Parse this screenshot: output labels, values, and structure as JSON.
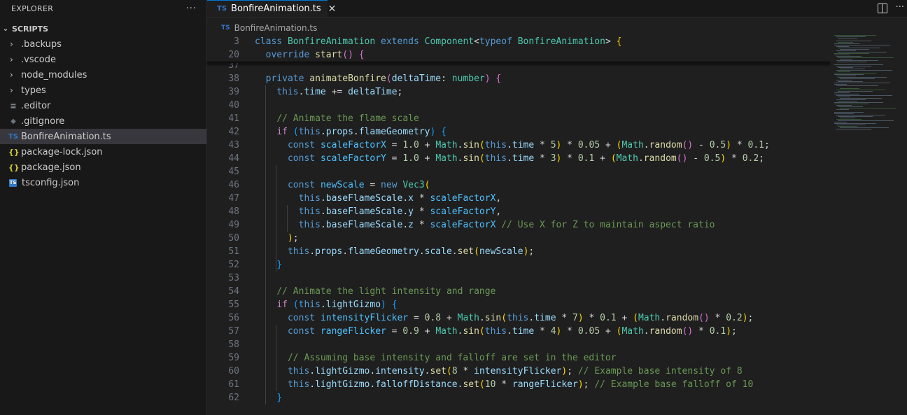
{
  "sidebar": {
    "title": "EXPLORER",
    "more": "···",
    "section": "SCRIPTS",
    "folders": [
      ".backups",
      ".vscode",
      "node_modules",
      "types"
    ],
    "files": [
      {
        "name": ".editor",
        "icon": "lines-icon"
      },
      {
        "name": ".gitignore",
        "icon": "git-icon"
      },
      {
        "name": "BonfireAnimation.ts",
        "icon": "ts-icon"
      },
      {
        "name": "package-lock.json",
        "icon": "json-icon"
      },
      {
        "name": "package.json",
        "icon": "json-icon"
      },
      {
        "name": "tsconfig.json",
        "icon": "ts-config-icon"
      }
    ]
  },
  "tab": {
    "label": "BonfireAnimation.ts",
    "badge": "TS",
    "close": "✕"
  },
  "breadcrumb": {
    "badge": "TS",
    "file": "BonfireAnimation.ts"
  },
  "editor": {
    "sticky": [
      {
        "n": "3",
        "tokens": [
          [
            "kw",
            "class "
          ],
          [
            "ty",
            "BonfireAnimation "
          ],
          [
            "kw",
            "extends "
          ],
          [
            "ty",
            "Component"
          ],
          [
            "pl",
            "<"
          ],
          [
            "kw",
            "typeof "
          ],
          [
            "ty",
            "BonfireAnimation"
          ],
          [
            "pl",
            "> "
          ],
          [
            "b1",
            "{"
          ]
        ]
      },
      {
        "n": "20",
        "tokens": [
          [
            "pl",
            "  "
          ],
          [
            "kw",
            "override "
          ],
          [
            "fn",
            "start"
          ],
          [
            "b2",
            "()"
          ],
          [
            "pl",
            " "
          ],
          [
            "b2",
            "{"
          ]
        ]
      }
    ],
    "lines": [
      {
        "n": "37",
        "tokens": []
      },
      {
        "n": "38",
        "tokens": [
          [
            "pl",
            "  "
          ],
          [
            "kw",
            "private "
          ],
          [
            "fn",
            "animateBonfire"
          ],
          [
            "b2",
            "("
          ],
          [
            "vr",
            "deltaTime"
          ],
          [
            "pl",
            ": "
          ],
          [
            "ty",
            "number"
          ],
          [
            "b2",
            ")"
          ],
          [
            "pl",
            " "
          ],
          [
            "b2",
            "{"
          ]
        ]
      },
      {
        "n": "39",
        "tokens": [
          [
            "pl",
            "    "
          ],
          [
            "kw",
            "this"
          ],
          [
            "pl",
            "."
          ],
          [
            "vr",
            "time"
          ],
          [
            "pl",
            " += "
          ],
          [
            "vr",
            "deltaTime"
          ],
          [
            "pl",
            ";"
          ]
        ]
      },
      {
        "n": "40",
        "tokens": []
      },
      {
        "n": "41",
        "tokens": [
          [
            "pl",
            "    "
          ],
          [
            "cm",
            "// Animate the flame scale"
          ]
        ]
      },
      {
        "n": "42",
        "tokens": [
          [
            "pl",
            "    "
          ],
          [
            "ck",
            "if "
          ],
          [
            "b3",
            "("
          ],
          [
            "kw",
            "this"
          ],
          [
            "pl",
            "."
          ],
          [
            "vr",
            "props"
          ],
          [
            "pl",
            "."
          ],
          [
            "vr",
            "flameGeometry"
          ],
          [
            "b3",
            ")"
          ],
          [
            "pl",
            " "
          ],
          [
            "b3",
            "{"
          ]
        ]
      },
      {
        "n": "43",
        "tokens": [
          [
            "pl",
            "      "
          ],
          [
            "kw",
            "const "
          ],
          [
            "cn",
            "scaleFactorX"
          ],
          [
            "pl",
            " = "
          ],
          [
            "nm",
            "1.0"
          ],
          [
            "pl",
            " + "
          ],
          [
            "ty",
            "Math"
          ],
          [
            "pl",
            "."
          ],
          [
            "fn",
            "sin"
          ],
          [
            "b1",
            "("
          ],
          [
            "kw",
            "this"
          ],
          [
            "pl",
            "."
          ],
          [
            "vr",
            "time"
          ],
          [
            "pl",
            " * "
          ],
          [
            "nm",
            "5"
          ],
          [
            "b1",
            ")"
          ],
          [
            "pl",
            " * "
          ],
          [
            "nm",
            "0.05"
          ],
          [
            "pl",
            " + "
          ],
          [
            "b1",
            "("
          ],
          [
            "ty",
            "Math"
          ],
          [
            "pl",
            "."
          ],
          [
            "fn",
            "random"
          ],
          [
            "b2",
            "()"
          ],
          [
            "pl",
            " - "
          ],
          [
            "nm",
            "0.5"
          ],
          [
            "b1",
            ")"
          ],
          [
            "pl",
            " * "
          ],
          [
            "nm",
            "0.1"
          ],
          [
            "pl",
            ";"
          ]
        ]
      },
      {
        "n": "44",
        "tokens": [
          [
            "pl",
            "      "
          ],
          [
            "kw",
            "const "
          ],
          [
            "cn",
            "scaleFactorY"
          ],
          [
            "pl",
            " = "
          ],
          [
            "nm",
            "1.0"
          ],
          [
            "pl",
            " + "
          ],
          [
            "ty",
            "Math"
          ],
          [
            "pl",
            "."
          ],
          [
            "fn",
            "sin"
          ],
          [
            "b1",
            "("
          ],
          [
            "kw",
            "this"
          ],
          [
            "pl",
            "."
          ],
          [
            "vr",
            "time"
          ],
          [
            "pl",
            " * "
          ],
          [
            "nm",
            "3"
          ],
          [
            "b1",
            ")"
          ],
          [
            "pl",
            " * "
          ],
          [
            "nm",
            "0.1"
          ],
          [
            "pl",
            " + "
          ],
          [
            "b1",
            "("
          ],
          [
            "ty",
            "Math"
          ],
          [
            "pl",
            "."
          ],
          [
            "fn",
            "random"
          ],
          [
            "b2",
            "()"
          ],
          [
            "pl",
            " - "
          ],
          [
            "nm",
            "0.5"
          ],
          [
            "b1",
            ")"
          ],
          [
            "pl",
            " * "
          ],
          [
            "nm",
            "0.2"
          ],
          [
            "pl",
            ";"
          ]
        ]
      },
      {
        "n": "45",
        "tokens": []
      },
      {
        "n": "46",
        "tokens": [
          [
            "pl",
            "      "
          ],
          [
            "kw",
            "const "
          ],
          [
            "cn",
            "newScale"
          ],
          [
            "pl",
            " = "
          ],
          [
            "kw",
            "new "
          ],
          [
            "ty",
            "Vec3"
          ],
          [
            "b1",
            "("
          ]
        ]
      },
      {
        "n": "47",
        "tokens": [
          [
            "pl",
            "        "
          ],
          [
            "kw",
            "this"
          ],
          [
            "pl",
            "."
          ],
          [
            "vr",
            "baseFlameScale"
          ],
          [
            "pl",
            "."
          ],
          [
            "vr",
            "x"
          ],
          [
            "pl",
            " * "
          ],
          [
            "cn",
            "scaleFactorX"
          ],
          [
            "pl",
            ","
          ]
        ]
      },
      {
        "n": "48",
        "tokens": [
          [
            "pl",
            "        "
          ],
          [
            "kw",
            "this"
          ],
          [
            "pl",
            "."
          ],
          [
            "vr",
            "baseFlameScale"
          ],
          [
            "pl",
            "."
          ],
          [
            "vr",
            "y"
          ],
          [
            "pl",
            " * "
          ],
          [
            "cn",
            "scaleFactorY"
          ],
          [
            "pl",
            ","
          ]
        ]
      },
      {
        "n": "49",
        "tokens": [
          [
            "pl",
            "        "
          ],
          [
            "kw",
            "this"
          ],
          [
            "pl",
            "."
          ],
          [
            "vr",
            "baseFlameScale"
          ],
          [
            "pl",
            "."
          ],
          [
            "vr",
            "z"
          ],
          [
            "pl",
            " * "
          ],
          [
            "cn",
            "scaleFactorX"
          ],
          [
            "pl",
            " "
          ],
          [
            "cm",
            "// Use X for Z to maintain aspect ratio"
          ]
        ]
      },
      {
        "n": "50",
        "tokens": [
          [
            "pl",
            "      "
          ],
          [
            "b1",
            ")"
          ],
          [
            "pl",
            ";"
          ]
        ]
      },
      {
        "n": "51",
        "tokens": [
          [
            "pl",
            "      "
          ],
          [
            "kw",
            "this"
          ],
          [
            "pl",
            "."
          ],
          [
            "vr",
            "props"
          ],
          [
            "pl",
            "."
          ],
          [
            "vr",
            "flameGeometry"
          ],
          [
            "pl",
            "."
          ],
          [
            "vr",
            "scale"
          ],
          [
            "pl",
            "."
          ],
          [
            "fn",
            "set"
          ],
          [
            "b1",
            "("
          ],
          [
            "vr",
            "newScale"
          ],
          [
            "b1",
            ")"
          ],
          [
            "pl",
            ";"
          ]
        ]
      },
      {
        "n": "52",
        "tokens": [
          [
            "pl",
            "    "
          ],
          [
            "b3",
            "}"
          ]
        ]
      },
      {
        "n": "53",
        "tokens": []
      },
      {
        "n": "54",
        "tokens": [
          [
            "pl",
            "    "
          ],
          [
            "cm",
            "// Animate the light intensity and range"
          ]
        ]
      },
      {
        "n": "55",
        "tokens": [
          [
            "pl",
            "    "
          ],
          [
            "ck",
            "if "
          ],
          [
            "b3",
            "("
          ],
          [
            "kw",
            "this"
          ],
          [
            "pl",
            "."
          ],
          [
            "vr",
            "lightGizmo"
          ],
          [
            "b3",
            ")"
          ],
          [
            "pl",
            " "
          ],
          [
            "b3",
            "{"
          ]
        ]
      },
      {
        "n": "56",
        "tokens": [
          [
            "pl",
            "      "
          ],
          [
            "kw",
            "const "
          ],
          [
            "cn",
            "intensityFlicker"
          ],
          [
            "pl",
            " = "
          ],
          [
            "nm",
            "0.8"
          ],
          [
            "pl",
            " + "
          ],
          [
            "ty",
            "Math"
          ],
          [
            "pl",
            "."
          ],
          [
            "fn",
            "sin"
          ],
          [
            "b1",
            "("
          ],
          [
            "kw",
            "this"
          ],
          [
            "pl",
            "."
          ],
          [
            "vr",
            "time"
          ],
          [
            "pl",
            " * "
          ],
          [
            "nm",
            "7"
          ],
          [
            "b1",
            ")"
          ],
          [
            "pl",
            " * "
          ],
          [
            "nm",
            "0.1"
          ],
          [
            "pl",
            " + "
          ],
          [
            "b1",
            "("
          ],
          [
            "ty",
            "Math"
          ],
          [
            "pl",
            "."
          ],
          [
            "fn",
            "random"
          ],
          [
            "b2",
            "()"
          ],
          [
            "pl",
            " * "
          ],
          [
            "nm",
            "0.2"
          ],
          [
            "b1",
            ")"
          ],
          [
            "pl",
            ";"
          ]
        ]
      },
      {
        "n": "57",
        "tokens": [
          [
            "pl",
            "      "
          ],
          [
            "kw",
            "const "
          ],
          [
            "cn",
            "rangeFlicker"
          ],
          [
            "pl",
            " = "
          ],
          [
            "nm",
            "0.9"
          ],
          [
            "pl",
            " + "
          ],
          [
            "ty",
            "Math"
          ],
          [
            "pl",
            "."
          ],
          [
            "fn",
            "sin"
          ],
          [
            "b1",
            "("
          ],
          [
            "kw",
            "this"
          ],
          [
            "pl",
            "."
          ],
          [
            "vr",
            "time"
          ],
          [
            "pl",
            " * "
          ],
          [
            "nm",
            "4"
          ],
          [
            "b1",
            ")"
          ],
          [
            "pl",
            " * "
          ],
          [
            "nm",
            "0.05"
          ],
          [
            "pl",
            " + "
          ],
          [
            "b1",
            "("
          ],
          [
            "ty",
            "Math"
          ],
          [
            "pl",
            "."
          ],
          [
            "fn",
            "random"
          ],
          [
            "b2",
            "()"
          ],
          [
            "pl",
            " * "
          ],
          [
            "nm",
            "0.1"
          ],
          [
            "b1",
            ")"
          ],
          [
            "pl",
            ";"
          ]
        ]
      },
      {
        "n": "58",
        "tokens": []
      },
      {
        "n": "59",
        "tokens": [
          [
            "pl",
            "      "
          ],
          [
            "cm",
            "// Assuming base intensity and falloff are set in the editor"
          ]
        ]
      },
      {
        "n": "60",
        "tokens": [
          [
            "pl",
            "      "
          ],
          [
            "kw",
            "this"
          ],
          [
            "pl",
            "."
          ],
          [
            "vr",
            "lightGizmo"
          ],
          [
            "pl",
            "."
          ],
          [
            "vr",
            "intensity"
          ],
          [
            "pl",
            "."
          ],
          [
            "fn",
            "set"
          ],
          [
            "b1",
            "("
          ],
          [
            "nm",
            "8"
          ],
          [
            "pl",
            " * "
          ],
          [
            "vr",
            "intensityFlicker"
          ],
          [
            "b1",
            ")"
          ],
          [
            "pl",
            "; "
          ],
          [
            "cm",
            "// Example base intensity of 8"
          ]
        ]
      },
      {
        "n": "61",
        "tokens": [
          [
            "pl",
            "      "
          ],
          [
            "kw",
            "this"
          ],
          [
            "pl",
            "."
          ],
          [
            "vr",
            "lightGizmo"
          ],
          [
            "pl",
            "."
          ],
          [
            "vr",
            "falloffDistance"
          ],
          [
            "pl",
            "."
          ],
          [
            "fn",
            "set"
          ],
          [
            "b1",
            "("
          ],
          [
            "nm",
            "10"
          ],
          [
            "pl",
            " * "
          ],
          [
            "vr",
            "rangeFlicker"
          ],
          [
            "b1",
            ")"
          ],
          [
            "pl",
            "; "
          ],
          [
            "cm",
            "// Example base falloff of 10"
          ]
        ]
      },
      {
        "n": "62",
        "tokens": [
          [
            "pl",
            "    "
          ],
          [
            "b3",
            "}"
          ]
        ]
      }
    ]
  }
}
